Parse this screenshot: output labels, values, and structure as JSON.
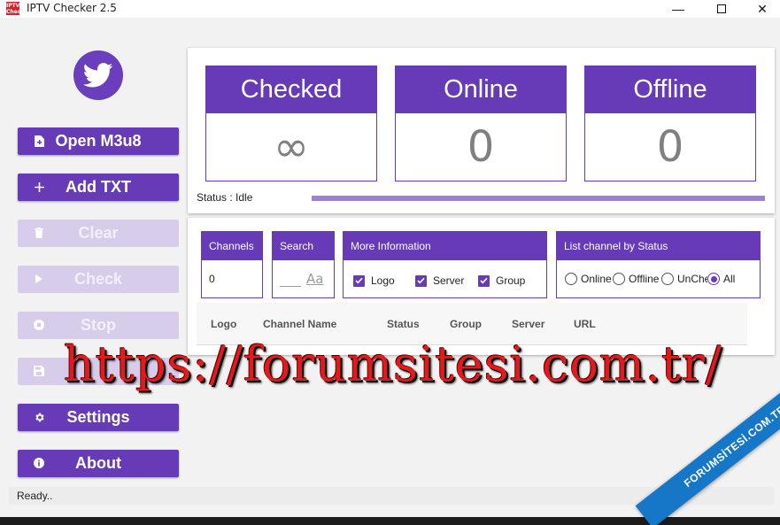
{
  "window": {
    "title": "IPTV Checker 2.5",
    "icon_text": "IPTV Checker",
    "minimize_glyph": "—",
    "close_glyph": "✕"
  },
  "sidebar": {
    "buttons": [
      {
        "label": "Open M3u8",
        "icon": "file-import-icon",
        "enabled": true
      },
      {
        "label": "Add TXT",
        "icon": "plus-icon",
        "enabled": true
      },
      {
        "label": "Clear",
        "icon": "trash-icon",
        "enabled": false
      },
      {
        "label": "Check",
        "icon": "play-icon",
        "enabled": false
      },
      {
        "label": "Stop",
        "icon": "stop-icon",
        "enabled": false
      },
      {
        "label": "",
        "icon": "save-icon",
        "enabled": false
      },
      {
        "label": "Settings",
        "icon": "gear-icon",
        "enabled": true
      },
      {
        "label": "About",
        "icon": "info-icon",
        "enabled": true
      }
    ]
  },
  "stats": {
    "checked": {
      "label": "Checked",
      "value": "∞"
    },
    "online": {
      "label": "Online",
      "value": "0"
    },
    "offline": {
      "label": "Offline",
      "value": "0"
    }
  },
  "status": {
    "label": "Status : Idle",
    "progress": 1.0
  },
  "filters": {
    "channels": {
      "label": "Channels",
      "value": "0"
    },
    "search": {
      "label": "Search",
      "value": "",
      "icon": "text-format-icon",
      "icon_text": "Aa"
    },
    "more_info": {
      "label": "More Information",
      "options": [
        {
          "label": "Logo",
          "checked": true
        },
        {
          "label": "Server",
          "checked": true
        },
        {
          "label": "Group",
          "checked": true
        }
      ]
    },
    "by_status": {
      "label": "List channel by Status",
      "options": [
        {
          "label": "Online",
          "checked": false
        },
        {
          "label": "Offline",
          "checked": false
        },
        {
          "label": "UnCheck",
          "checked": false
        },
        {
          "label": "All",
          "checked": true
        }
      ]
    }
  },
  "table": {
    "columns": [
      "Logo",
      "Channel Name",
      "Status",
      "Group",
      "Server",
      "URL"
    ]
  },
  "statusbar": {
    "text": "Ready.."
  },
  "watermark": {
    "url": "https://forumsitesi.com.tr/",
    "ribbon": "FORUMSİTESİ.COM.TR"
  },
  "colors": {
    "accent": "#673ab7",
    "accent_disabled": "#d7cdeb",
    "watermark": "#e11b1b",
    "ribbon": "#1677c9"
  }
}
